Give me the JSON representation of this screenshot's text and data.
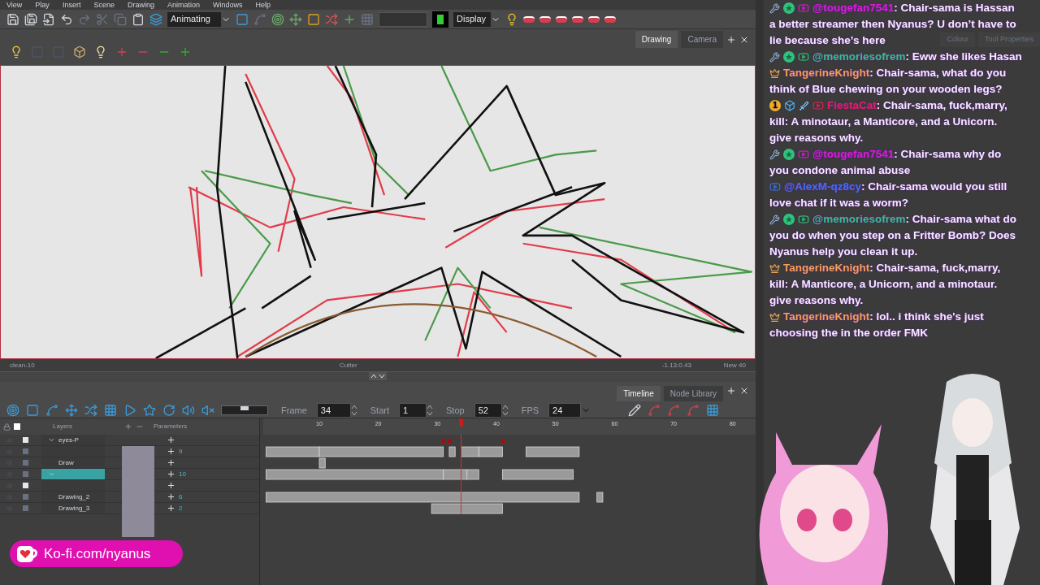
{
  "menu": [
    "View",
    "Play",
    "Insert",
    "Scene",
    "Drawing",
    "Animation",
    "Windows",
    "Help"
  ],
  "toolbar": {
    "mode": "Animating",
    "display": "Display"
  },
  "view_tabs": [
    {
      "label": "Drawing",
      "selected": true
    },
    {
      "label": "Camera",
      "selected": false
    }
  ],
  "status_bar": {
    "left": "clean-10",
    "center": "Cutter",
    "coords": "-1.13:0.43",
    "zoom": "New 40"
  },
  "timeline_toolbar": {
    "speed_slider": {
      "level": 0.5
    },
    "frame_label": "Frame",
    "frame": "34",
    "start_label": "Start",
    "start": "1",
    "stop_label": "Stop",
    "stop": "52",
    "fps_label": "FPS",
    "fps": "24"
  },
  "timeline_tabs": [
    {
      "label": "Timeline",
      "selected": true
    },
    {
      "label": "Node Library",
      "selected": false
    }
  ],
  "layers_header": {
    "layers": "Layers",
    "parameters": "Parameters"
  },
  "layers": [
    {
      "name": "eyes-P",
      "expanded": true,
      "selected": false
    },
    {
      "param": "9",
      "expanded": false,
      "selected": false
    },
    {
      "name": "Draw",
      "expanded": false,
      "selected": false
    },
    {
      "param": "10",
      "expanded": true,
      "selected": true
    },
    {
      "expanded": false,
      "selected": false
    },
    {
      "name": "Drawing_2",
      "param": "6",
      "expanded": false,
      "selected": false
    },
    {
      "name": "Drawing_3",
      "param": "2",
      "expanded": false,
      "selected": false
    }
  ],
  "ruler_labels": [
    "10",
    "20",
    "30",
    "40",
    "50",
    "60",
    "70",
    "80"
  ],
  "side_tabs": [
    "Colour",
    "Tool Properties"
  ],
  "kofi": "Ko-fi.com/nyanus",
  "chat": [
    {
      "badges": [
        {
          "kind": "wrench"
        },
        {
          "kind": "star"
        },
        {
          "kind": "video"
        }
      ],
      "user": "@tougefan7541",
      "color": "#d81bd8",
      "lines": [
        ": Chair-sama is Hassan",
        "a better streamer then Nyanus? U don’t have to",
        "lie because she’s here"
      ]
    },
    {
      "badges": [
        {
          "kind": "wrench"
        },
        {
          "kind": "star"
        },
        {
          "kind": "video"
        }
      ],
      "user": "@memoriesofrem",
      "color": "#2ec27e",
      "lines": [
        ": Eww she likes Hasan"
      ]
    },
    {
      "badges": [
        {
          "kind": "knight"
        }
      ],
      "user": "TangerineKnight",
      "color": "#f0a050",
      "lines": [
        ": Chair-sama, what do you",
        "think of Blue chewing on your wooden legs?"
      ]
    },
    {
      "badges": [
        {
          "kind": "level",
          "label": "1"
        },
        {
          "kind": "cube"
        },
        {
          "kind": "sword"
        },
        {
          "kind": "video"
        }
      ],
      "user": "FiestaCat",
      "color": "#e0205a",
      "lines": [
        ": Chair-sama, fuck,marry,",
        "kill: A minotaur, a Manticore, and a Unicorn.",
        "give reasons why."
      ]
    },
    {
      "badges": [
        {
          "kind": "wrench"
        },
        {
          "kind": "star"
        },
        {
          "kind": "video"
        }
      ],
      "user": "@tougefan7541",
      "color": "#d81bd8",
      "lines": [
        ": Chair-sama why do",
        "you condone animal abuse"
      ]
    },
    {
      "badges": [
        {
          "kind": "video"
        }
      ],
      "user": "@AlexM-qz8cy",
      "color": "#3b6ff0",
      "lines": [
        ": Chair-sama would you still",
        "love chat if it was a worm?"
      ]
    },
    {
      "badges": [
        {
          "kind": "wrench"
        },
        {
          "kind": "star"
        },
        {
          "kind": "video"
        }
      ],
      "user": "@memoriesofrem",
      "color": "#2ec27e",
      "lines": [
        ": Chair-sama what do",
        "you do when you step on a Fritter Bomb? Does",
        "Nyanus help you clean it up."
      ]
    },
    {
      "badges": [
        {
          "kind": "knight"
        }
      ],
      "user": "TangerineKnight",
      "color": "#f0a050",
      "lines": [
        ": Chair-sama, fuck,marry,",
        "kill: A Manticore, a Unicorn, and a minotaur.",
        "give reasons why."
      ]
    },
    {
      "badges": [
        {
          "kind": "knight"
        }
      ],
      "user": "TangerineKnight",
      "color": "#f0a050",
      "lines": [
        ": lol.. i think she's just",
        "choosing the in the order FMK"
      ]
    }
  ]
}
